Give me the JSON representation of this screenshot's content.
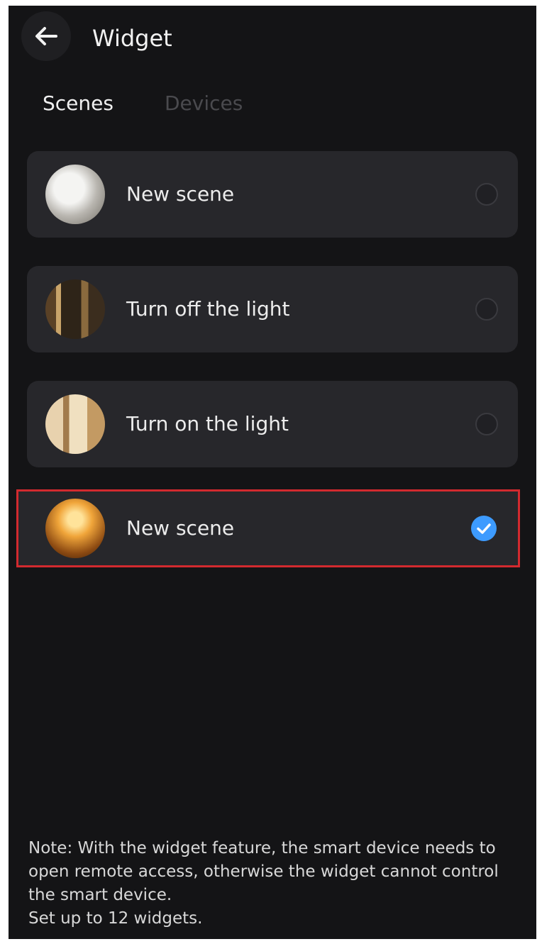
{
  "header": {
    "title": "Widget",
    "back_icon": "arrow-left-icon"
  },
  "tabs": [
    {
      "label": "Scenes",
      "active": true
    },
    {
      "label": "Devices",
      "active": false
    }
  ],
  "scenes": [
    {
      "name": "New scene",
      "thumbnail": "kitchen-image",
      "selected": false
    },
    {
      "name": "Turn off the light",
      "thumbnail": "dark-room-image",
      "selected": false
    },
    {
      "name": "Turn on the light",
      "thumbnail": "lit-room-image",
      "selected": false
    },
    {
      "name": "New scene",
      "thumbnail": "sunset-image",
      "selected": true
    }
  ],
  "note": {
    "text": "Note: With the widget feature, the smart device needs to open remote access, otherwise the widget cannot control the smart device.",
    "limit": "Set up to 12 widgets."
  },
  "colors": {
    "background": "#141416",
    "card": "#27272b",
    "accent": "#3d9bff",
    "highlight_outline": "#d22a2f"
  }
}
